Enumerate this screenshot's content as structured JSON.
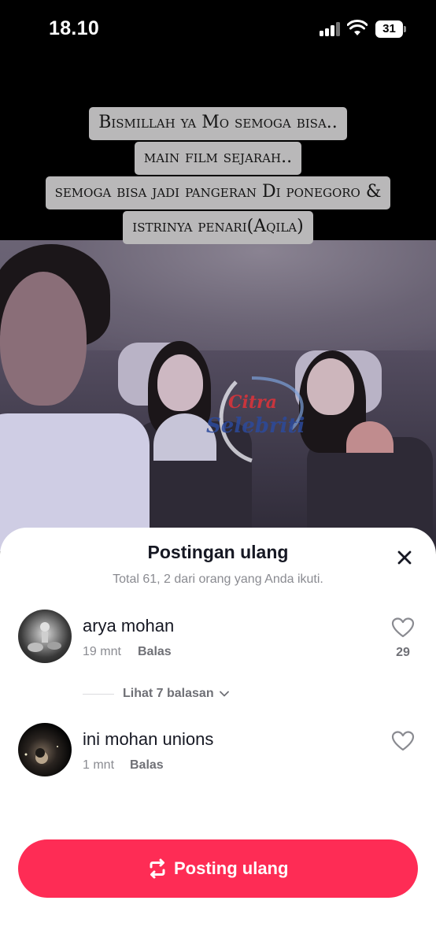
{
  "status_bar": {
    "time": "18.10",
    "battery": "31"
  },
  "video": {
    "caption_lines": [
      "Bismillah ya Mo semoga bisa..",
      "main film sejarah..",
      "semoga bisa jadi pangeran Di ponegoro &",
      "istrinya penari(Aqila)"
    ],
    "watermark_top": "Citra",
    "watermark_bottom": "Selebriti"
  },
  "sheet": {
    "title": "Postingan ulang",
    "subtitle": "Total 61, 2 dari orang yang Anda ikuti.",
    "items": [
      {
        "name": "arya mohan",
        "time": "19 mnt",
        "reply": "Balas",
        "likes": "29"
      },
      {
        "name": "ini mohan unions",
        "time": "1 mnt",
        "reply": "Balas",
        "likes": ""
      }
    ],
    "view_replies": "Lihat 7 balasan",
    "repost_button": "Posting ulang"
  },
  "colors": {
    "accent": "#fe2c55",
    "text_primary": "#161823",
    "text_secondary": "#8a8b91"
  }
}
